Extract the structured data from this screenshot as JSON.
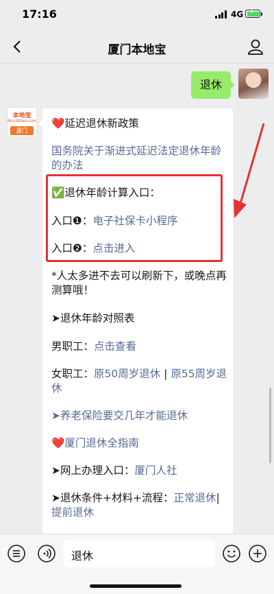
{
  "status": {
    "time": "17:16",
    "network": "4G"
  },
  "nav": {
    "title": "厦门本地宝"
  },
  "outgoing_message": {
    "text": "退休"
  },
  "account": {
    "logo_top": "本地宝",
    "logo_mid": "Bendibao.com",
    "logo_bottom": "厦门"
  },
  "incoming_message": {
    "heading_icon": "❤️",
    "heading": "延迟退休新政策",
    "policy_link": "国务院关于渐进式延迟法定退休年龄的办法",
    "calc_icon": "✅",
    "calc_title": "退休年龄计算入口：",
    "entry_label": "入口",
    "entry1_num": "❶",
    "entry1_link": "电子社保卡小程序",
    "entry2_num": "❷",
    "entry2_link": "点击进入",
    "retry_tip": "*人太多进不去可以刷新下，或晚点再测算哦！",
    "table_title": "➤退休年龄对照表",
    "male_label": "男职工：",
    "male_link": "点击查看",
    "female_label": "女职工：",
    "female_link1": "原50周岁退休",
    "separator": " | ",
    "female_link2": "原55周岁退休",
    "pension_link": "➤养老保险要交几年才能退休",
    "guide_icon": "❤️",
    "guide_link": "厦门退休全指南",
    "online_label": "➤网上办理入口：",
    "online_link": "厦门人社",
    "conditions_label": "➤退休条件+材料+流程：",
    "normal_link": "正常退休",
    "early_separator": "| ",
    "early_link": "提前退休"
  },
  "input": {
    "value": "退休"
  },
  "colors": {
    "link": "#576b95",
    "outgoing_bubble": "#95ec69",
    "highlight": "#e53232",
    "annotation_arrow": "#e53232"
  },
  "icons": [
    "back-icon",
    "profile-icon",
    "menu-icon",
    "voice-icon",
    "emoji-icon",
    "plus-icon"
  ]
}
